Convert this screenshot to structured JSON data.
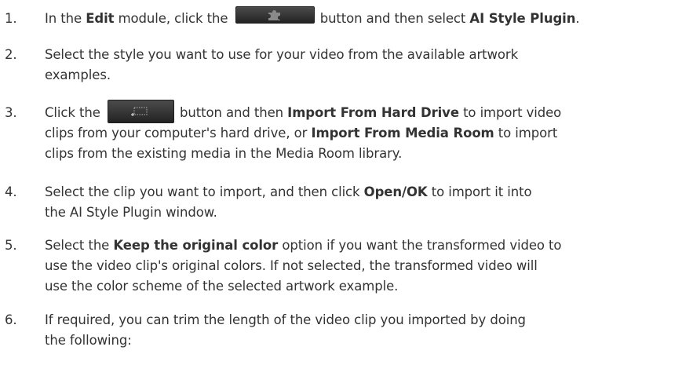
{
  "steps": [
    {
      "number": "1.",
      "t1": "In the ",
      "b1": "Edit",
      "t2": " module, click the ",
      "t3": " button and then select ",
      "b2": "AI Style Plugin",
      "t4": ".",
      "icon": "plugin-puzzle-icon"
    },
    {
      "number": "2.",
      "line1": "Select the style you want to use for your video from the available artwork",
      "line2": "examples."
    },
    {
      "number": "3.",
      "t1": "Click the ",
      "t2": " button and then ",
      "b1": "Import From Hard Drive",
      "t3": " to import video",
      "t4": "clips from your computer's hard drive, or ",
      "b2": "Import From Media Room",
      "t5": " to import",
      "t6": "clips from the existing media in the Media Room library.",
      "icon": "import-media-icon"
    },
    {
      "number": "4.",
      "t1": "Select the clip you want to import, and then click ",
      "b1": "Open/OK",
      "t2": " to import it into",
      "t3": "the AI Style Plugin window."
    },
    {
      "number": "5.",
      "t1": "Select the ",
      "b1": "Keep the original color",
      "t2": " option if you want the transformed video to",
      "t3": "use the video clip's original colors. If not selected, the transformed video will",
      "t4": "use the color scheme of the selected artwork example."
    },
    {
      "number": "6.",
      "line1": "If required, you can trim the length of the video clip you imported by doing",
      "line2": "the following:"
    }
  ]
}
